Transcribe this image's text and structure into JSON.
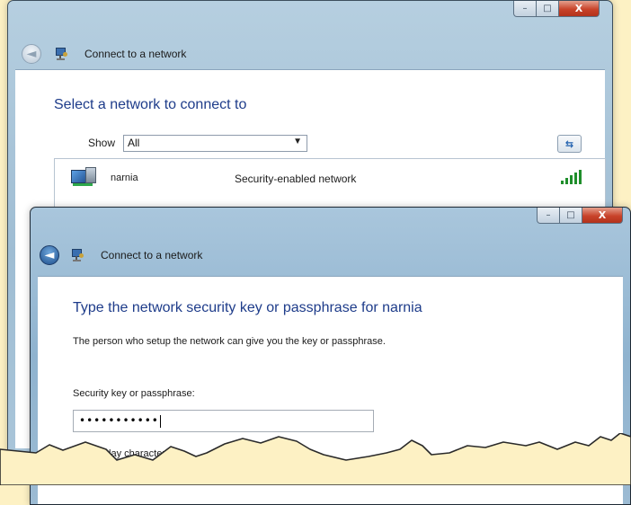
{
  "colors": {
    "background": "#fdf1c4",
    "heading": "#1e3c8a",
    "signal": "#1f8e2b",
    "close": "#c8432a"
  },
  "window_controls": {
    "minimize": "–",
    "maximize": "□",
    "close": "X"
  },
  "back_window": {
    "title": "Connect to a network",
    "back_button": "◄",
    "heading": "Select a network to connect to",
    "show_label": "Show",
    "show_value": "All",
    "refresh_icon": "⇆",
    "networks": [
      {
        "name": "narnia",
        "security": "Security-enabled network",
        "icon": "computer-network-icon",
        "signal": 5
      }
    ]
  },
  "front_window": {
    "title": "Connect to a network",
    "back_button": "◄",
    "heading": "Type the network security key or passphrase for narnia",
    "description": "The person who setup the network can give you the key or passphrase.",
    "field_label": "Security key or passphrase:",
    "field_value": "•••••••••••",
    "checkbox_label": "Display characters",
    "checkbox_checked": false
  }
}
